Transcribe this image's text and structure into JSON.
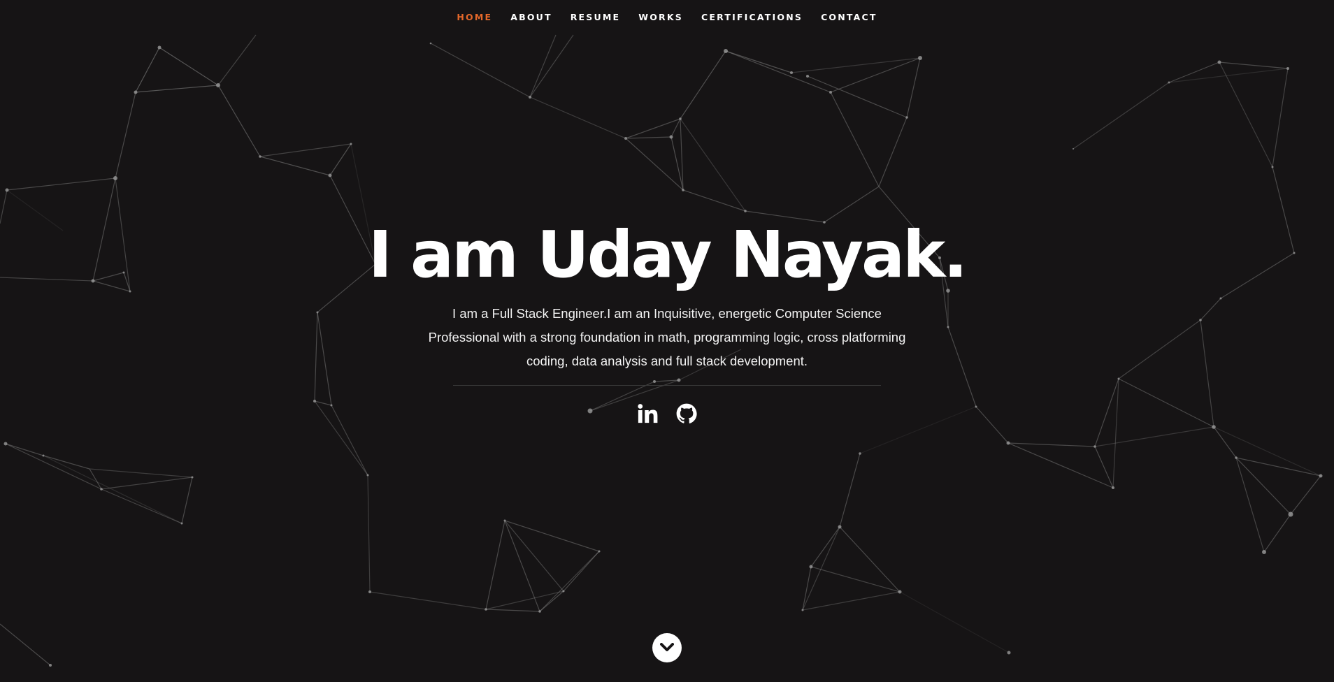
{
  "nav": {
    "items": [
      {
        "label": "HOME",
        "active": true
      },
      {
        "label": "ABOUT",
        "active": false
      },
      {
        "label": "RESUME",
        "active": false
      },
      {
        "label": "WORKS",
        "active": false
      },
      {
        "label": "CERTIFICATIONS",
        "active": false
      },
      {
        "label": "CONTACT",
        "active": false
      }
    ]
  },
  "hero": {
    "title": "I am Uday Nayak.",
    "description": "I am a Full Stack Engineer.I am an Inquisitive, energetic Computer Science Professional with a strong foundation in math, programming logic, cross platforming coding, data analysis and full stack development."
  },
  "social": [
    {
      "icon": "linkedin-icon"
    },
    {
      "icon": "github-icon"
    }
  ],
  "scroll_down": {
    "icon": "chevron-down-icon"
  },
  "colors": {
    "background": "#161415",
    "accent": "#e4682a",
    "text": "#ffffff",
    "network": "#8a8a8a"
  }
}
